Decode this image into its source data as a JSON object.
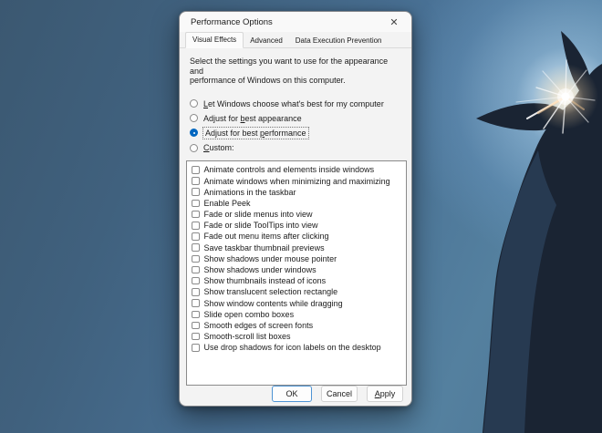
{
  "window": {
    "title": "Performance Options",
    "close_glyph": "✕"
  },
  "tabs": [
    {
      "label": "Visual Effects",
      "active": true
    },
    {
      "label": "Advanced",
      "active": false
    },
    {
      "label": "Data Execution Prevention",
      "active": false
    }
  ],
  "description": {
    "line1": "Select the settings you want to use for the appearance and",
    "line2": "performance of Windows on this computer."
  },
  "radios": [
    {
      "pre": "",
      "key": "L",
      "post": "et Windows choose what's best for my computer",
      "selected": false
    },
    {
      "pre": "Adjust for ",
      "key": "b",
      "post": "est appearance",
      "selected": false
    },
    {
      "pre": "Adjust for best ",
      "key": "p",
      "post": "erformance",
      "selected": true
    },
    {
      "pre": "",
      "key": "C",
      "post": "ustom:",
      "selected": false
    }
  ],
  "visual_effects_list": {
    "all_unchecked": true,
    "items": [
      "Animate controls and elements inside windows",
      "Animate windows when minimizing and maximizing",
      "Animations in the taskbar",
      "Enable Peek",
      "Fade or slide menus into view",
      "Fade or slide ToolTips into view",
      "Fade out menu items after clicking",
      "Save taskbar thumbnail previews",
      "Show shadows under mouse pointer",
      "Show shadows under windows",
      "Show thumbnails instead of icons",
      "Show translucent selection rectangle",
      "Show window contents while dragging",
      "Slide open combo boxes",
      "Smooth edges of screen fonts",
      "Smooth-scroll list boxes",
      "Use drop shadows for icon labels on the desktop"
    ]
  },
  "buttons": {
    "ok": "OK",
    "cancel": "Cancel",
    "apply": {
      "pre": "",
      "key": "A",
      "post": "pply"
    }
  },
  "colors": {
    "accent": "#0067c0",
    "default_button_border": "#4e94d4",
    "sky_dark": "#3b5871",
    "sky_light": "#9ec5e5",
    "statue": "#1a2433"
  }
}
